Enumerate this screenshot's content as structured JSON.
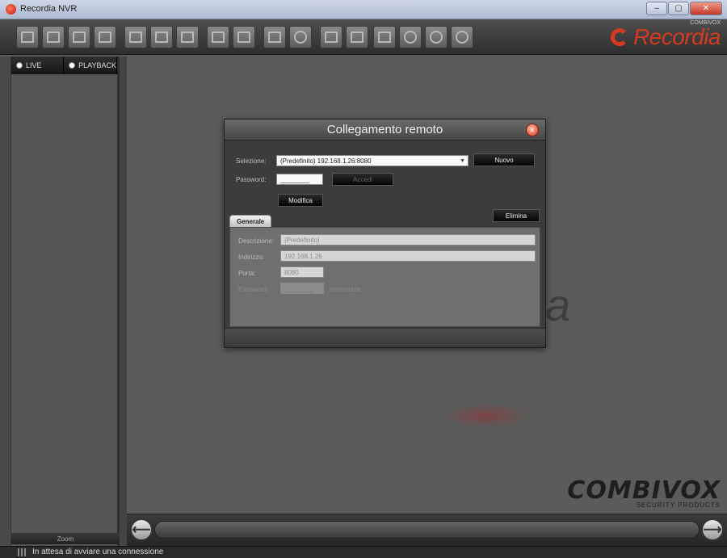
{
  "window": {
    "title": "Recordia NVR",
    "controls": [
      "–",
      "▢",
      "✕"
    ]
  },
  "toolbar": {
    "brand_text": "Recordia",
    "brand_small": "COMBIVOX"
  },
  "left_panel": {
    "tabs": [
      {
        "label": "LIVE",
        "selected": true
      },
      {
        "label": "PLAYBACK",
        "selected": false
      }
    ],
    "zoom_label": "Zoom"
  },
  "canvas": {
    "watermark_tail": "a",
    "combivox_logo": "COMBIVOX",
    "combivox_sub": "SECURITY PRODUCTS"
  },
  "navigation": {
    "prev_icon": "arrow-left-icon",
    "next_icon": "arrow-right-icon",
    "prev_glyph": "⟵",
    "next_glyph": "⟶"
  },
  "status": {
    "message": "In attesa di avviare una connessione"
  },
  "dialog": {
    "title": "Collegamento remoto",
    "selection_label": "Selezione:",
    "selection_value": "(Predefinito) 192.168.1.26:8080",
    "new_button": "Nuovo",
    "password_label": "Password:",
    "password_value": "________",
    "login_button": "Accedi",
    "modify_button": "Modifica",
    "delete_button": "Elimina",
    "tab_general": "Generale",
    "description_label": "Descrizione:",
    "description_value": "(Predefinito)",
    "address_label": "Indirizzo:",
    "address_value": "192.168.1.26",
    "port_label": "Porta:",
    "port_value": "8080",
    "password2_label": "Password:",
    "password2_value": "________",
    "remember_label": "memorizza"
  }
}
